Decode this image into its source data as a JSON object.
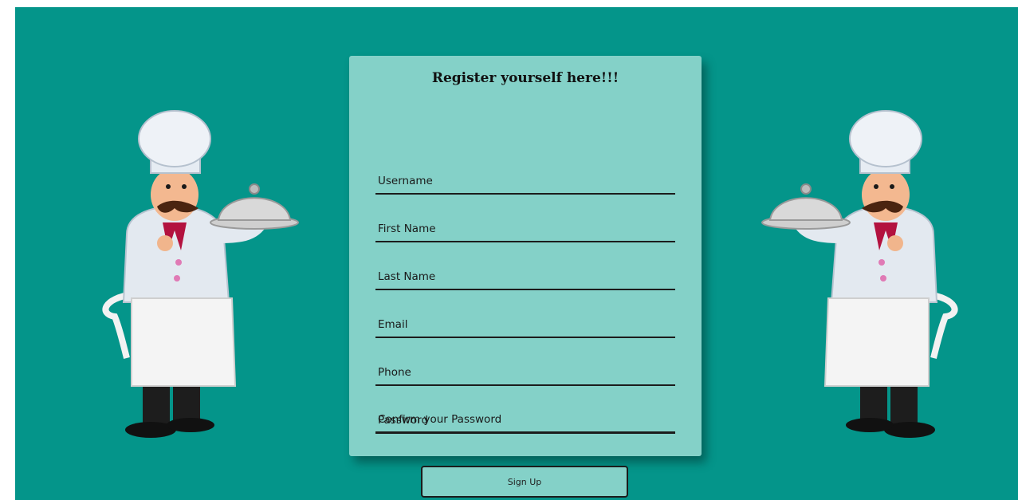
{
  "form": {
    "title": "Register yourself here!!!",
    "fields": [
      {
        "name": "username",
        "placeholder": "Username",
        "value": ""
      },
      {
        "name": "first-name",
        "placeholder": "First Name",
        "value": ""
      },
      {
        "name": "last-name",
        "placeholder": "Last Name",
        "value": ""
      },
      {
        "name": "email",
        "placeholder": "Email",
        "value": ""
      },
      {
        "name": "phone",
        "placeholder": "Phone",
        "value": ""
      },
      {
        "name": "password",
        "placeholder": "Password",
        "value": ""
      },
      {
        "name": "confirm-password",
        "placeholder": "Confirm your Password",
        "value": ""
      }
    ],
    "submit_label": "Sign Up"
  },
  "illustrations": {
    "left": "chef-with-cloche-icon",
    "right": "chef-with-cloche-icon"
  },
  "colors": {
    "background": "#04958a",
    "card": "#84d1c8",
    "underline": "#1c1c1c"
  }
}
